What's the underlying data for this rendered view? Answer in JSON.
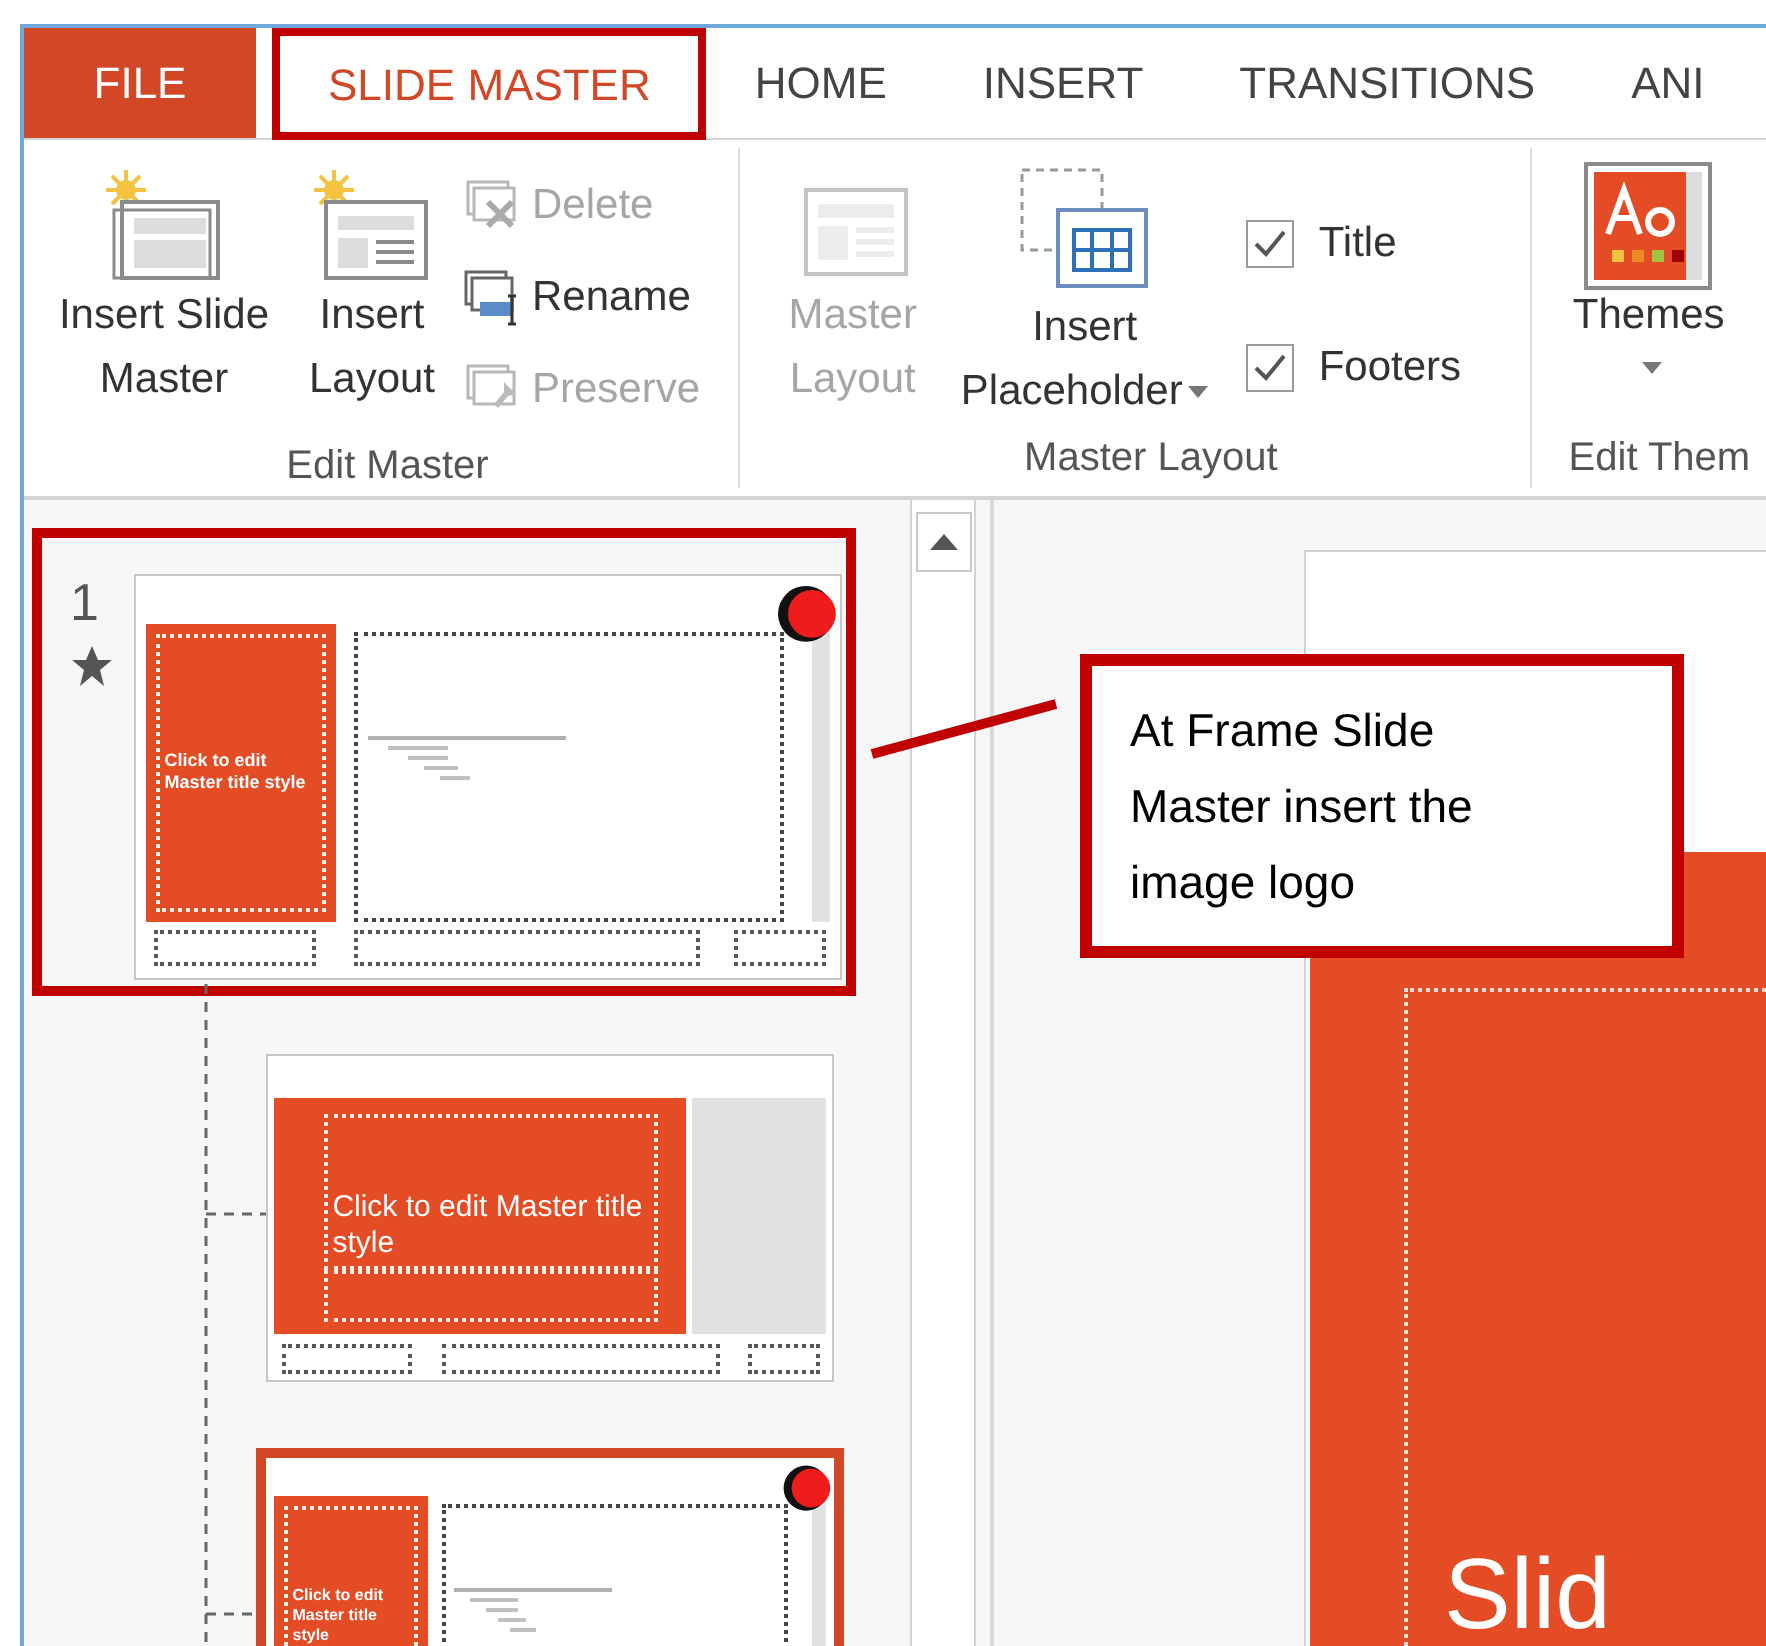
{
  "tabs": [
    {
      "label": "FILE",
      "kind": "file",
      "selected": false,
      "highlighted": false
    },
    {
      "label": "SLIDE MASTER",
      "kind": "tab",
      "selected": true,
      "highlighted": true
    },
    {
      "label": "HOME",
      "kind": "tab",
      "selected": false,
      "highlighted": false
    },
    {
      "label": "INSERT",
      "kind": "tab",
      "selected": false,
      "highlighted": false
    },
    {
      "label": "TRANSITIONS",
      "kind": "tab",
      "selected": false,
      "highlighted": false
    },
    {
      "label": "ANI",
      "kind": "tab",
      "selected": false,
      "highlighted": false
    }
  ],
  "ribbon_groups": [
    {
      "label": "Edit Master",
      "controls": [
        {
          "kind": "large",
          "label": "Insert Slide Master",
          "disabled": false
        },
        {
          "kind": "large",
          "label": "Insert Layout",
          "disabled": false
        },
        {
          "kind": "small-stack",
          "items": [
            {
              "label": "Delete",
              "disabled": true
            },
            {
              "label": "Rename",
              "disabled": false
            },
            {
              "label": "Preserve",
              "disabled": true
            }
          ]
        }
      ]
    },
    {
      "label": "Master Layout",
      "controls": [
        {
          "kind": "large",
          "label": "Master Layout",
          "disabled": true
        },
        {
          "kind": "large",
          "label": "Insert Placeholder",
          "disabled": false,
          "dropdown": true
        },
        {
          "kind": "checks",
          "items": [
            {
              "label": "Title",
              "checked": true
            },
            {
              "label": "Footers",
              "checked": true
            }
          ]
        }
      ]
    },
    {
      "label": "Edit Them",
      "controls": [
        {
          "kind": "large",
          "label": "Themes",
          "disabled": false,
          "dropdown": true
        }
      ]
    }
  ],
  "thumbnails": [
    {
      "number": "1",
      "starred": true,
      "kind": "title-left",
      "title": "Click to edit Master title style",
      "logo": true,
      "selected": false,
      "highlighted": true
    },
    {
      "kind": "title-wide",
      "title": "Click to edit Master title style",
      "logo": false,
      "selected": false,
      "highlighted": false
    },
    {
      "kind": "title-left",
      "title": "Click to edit Master title style",
      "logo": true,
      "selected": true,
      "highlighted": false
    }
  ],
  "slide": {
    "title": "Slid"
  },
  "callout": {
    "text": "At Frame Slide Master insert the image logo"
  }
}
